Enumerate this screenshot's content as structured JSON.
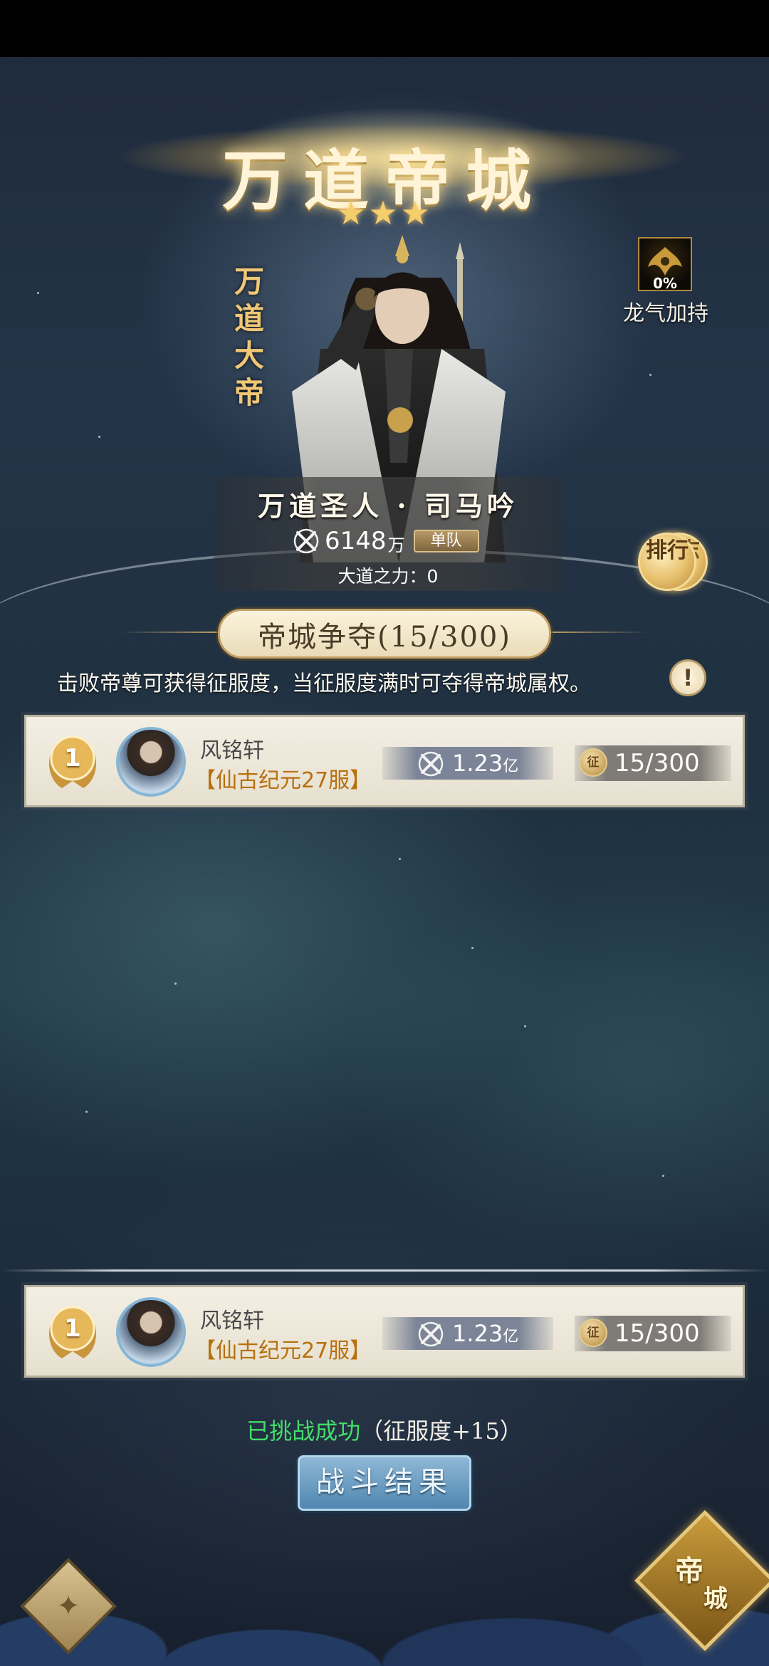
{
  "header": {
    "title": "万道帝城",
    "star_count": 3,
    "stars": "★★★"
  },
  "boss": {
    "vertical_title": "万道大帝",
    "name": "万道圣人 · 司马吟",
    "power_value": "6148",
    "power_unit": "万",
    "team_badge": "单队",
    "dadao_power": "大道之力：0"
  },
  "dragon_qi": {
    "percent": "0%",
    "label": "龙气加持",
    "icon": "dragon-emblem-icon"
  },
  "side_buttons": {
    "rank": "排行",
    "log": "日志"
  },
  "contest": {
    "title": "帝城争夺(15/300)",
    "description": "击败帝尊可获得征服度，当征服度满时可夺得帝城属权。",
    "info_symbol": "!"
  },
  "entries": [
    {
      "rank": "1",
      "name": "风铭轩",
      "server": "【仙古纪元27服】",
      "power": "1.23",
      "power_unit": "亿",
      "conquer_icon_text": "征",
      "conquer": "15/300"
    },
    {
      "rank": "1",
      "name": "风铭轩",
      "server": "【仙古纪元27服】",
      "power": "1.23",
      "power_unit": "亿",
      "conquer_icon_text": "征",
      "conquer": "15/300"
    }
  ],
  "result": {
    "success_text": "已挑战成功",
    "conquer_gain": "（征服度+15）"
  },
  "battle_result_button": "战斗结果",
  "bottom_nav": {
    "left_icon": "scroll-ornament-icon",
    "left_glyph": "✦",
    "city_char_1": "帝",
    "city_char_2": "城"
  },
  "colors": {
    "gold": "#f0c777",
    "success_green": "#43dd6a",
    "server_orange": "#b8700e"
  }
}
